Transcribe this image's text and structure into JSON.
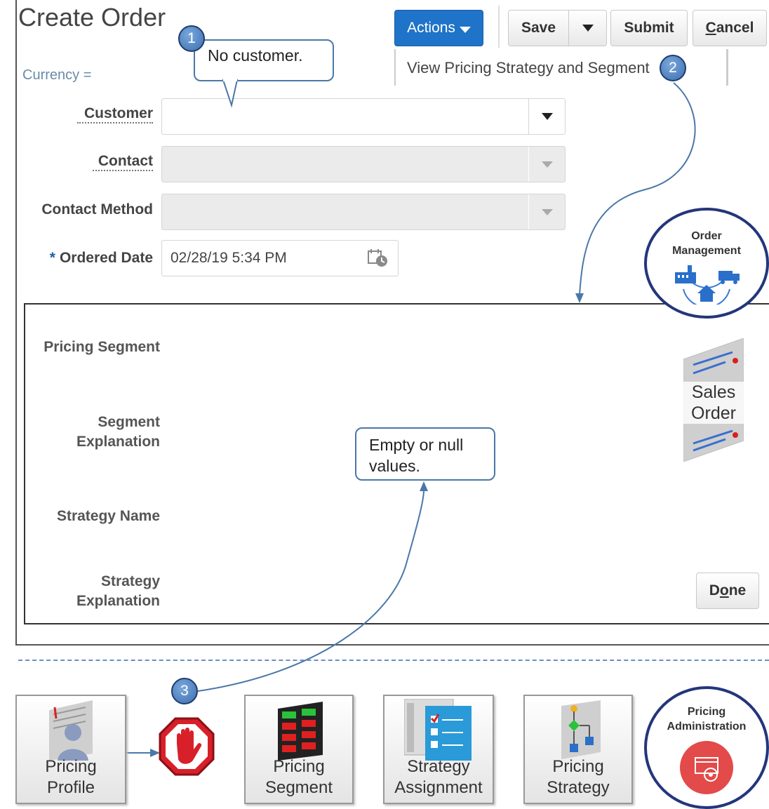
{
  "header": {
    "title": "Create Order",
    "currency_label": "Currency ="
  },
  "toolbar": {
    "actions_label": "Actions",
    "save_label": "Save",
    "submit_label": "Submit",
    "cancel_first": "C",
    "cancel_rest": "ancel"
  },
  "actions_menu": {
    "item": "View Pricing Strategy and Segment"
  },
  "callouts": {
    "badge1": "1",
    "badge2": "2",
    "badge3": "3",
    "callout1": "No customer.",
    "callout3_line1": "Empty or null",
    "callout3_line2": "values."
  },
  "form": {
    "customer_label": "Customer",
    "customer_value": "",
    "contact_label": "Contact",
    "contact_method_label": "Contact Method",
    "ordered_date_required": "*",
    "ordered_date_label": "Ordered Date",
    "ordered_date_value": "02/28/19 5:34 PM"
  },
  "dialog": {
    "pricing_segment_label": "Pricing Segment",
    "segment_explanation_line1": "Segment",
    "segment_explanation_line2": "Explanation",
    "strategy_name_label": "Strategy Name",
    "strategy_explanation_line1": "Strategy",
    "strategy_explanation_line2": "Explanation",
    "done_first": "D",
    "done_middle": "o",
    "done_rest": "ne"
  },
  "side_art": {
    "order_management_line1": "Order",
    "order_management_line2": "Management",
    "sales_order_line1": "Sales",
    "sales_order_line2": "Order"
  },
  "flow": {
    "pricing_profile_line1": "Pricing",
    "pricing_profile_line2": "Profile",
    "pricing_segment_line1": "Pricing",
    "pricing_segment_line2": "Segment",
    "strategy_assignment_line1": "Strategy",
    "strategy_assignment_line2": "Assignment",
    "pricing_strategy_line1": "Pricing",
    "pricing_strategy_line2": "Strategy",
    "pricing_admin_line1": "Pricing",
    "pricing_admin_line2": "Administration"
  },
  "colors": {
    "actions_blue": "#1f73c8",
    "callout_border": "#4a78a8",
    "badge_blue": "#3d6fb0",
    "logo_ring": "#24367a",
    "stop_red": "#d8202a"
  }
}
